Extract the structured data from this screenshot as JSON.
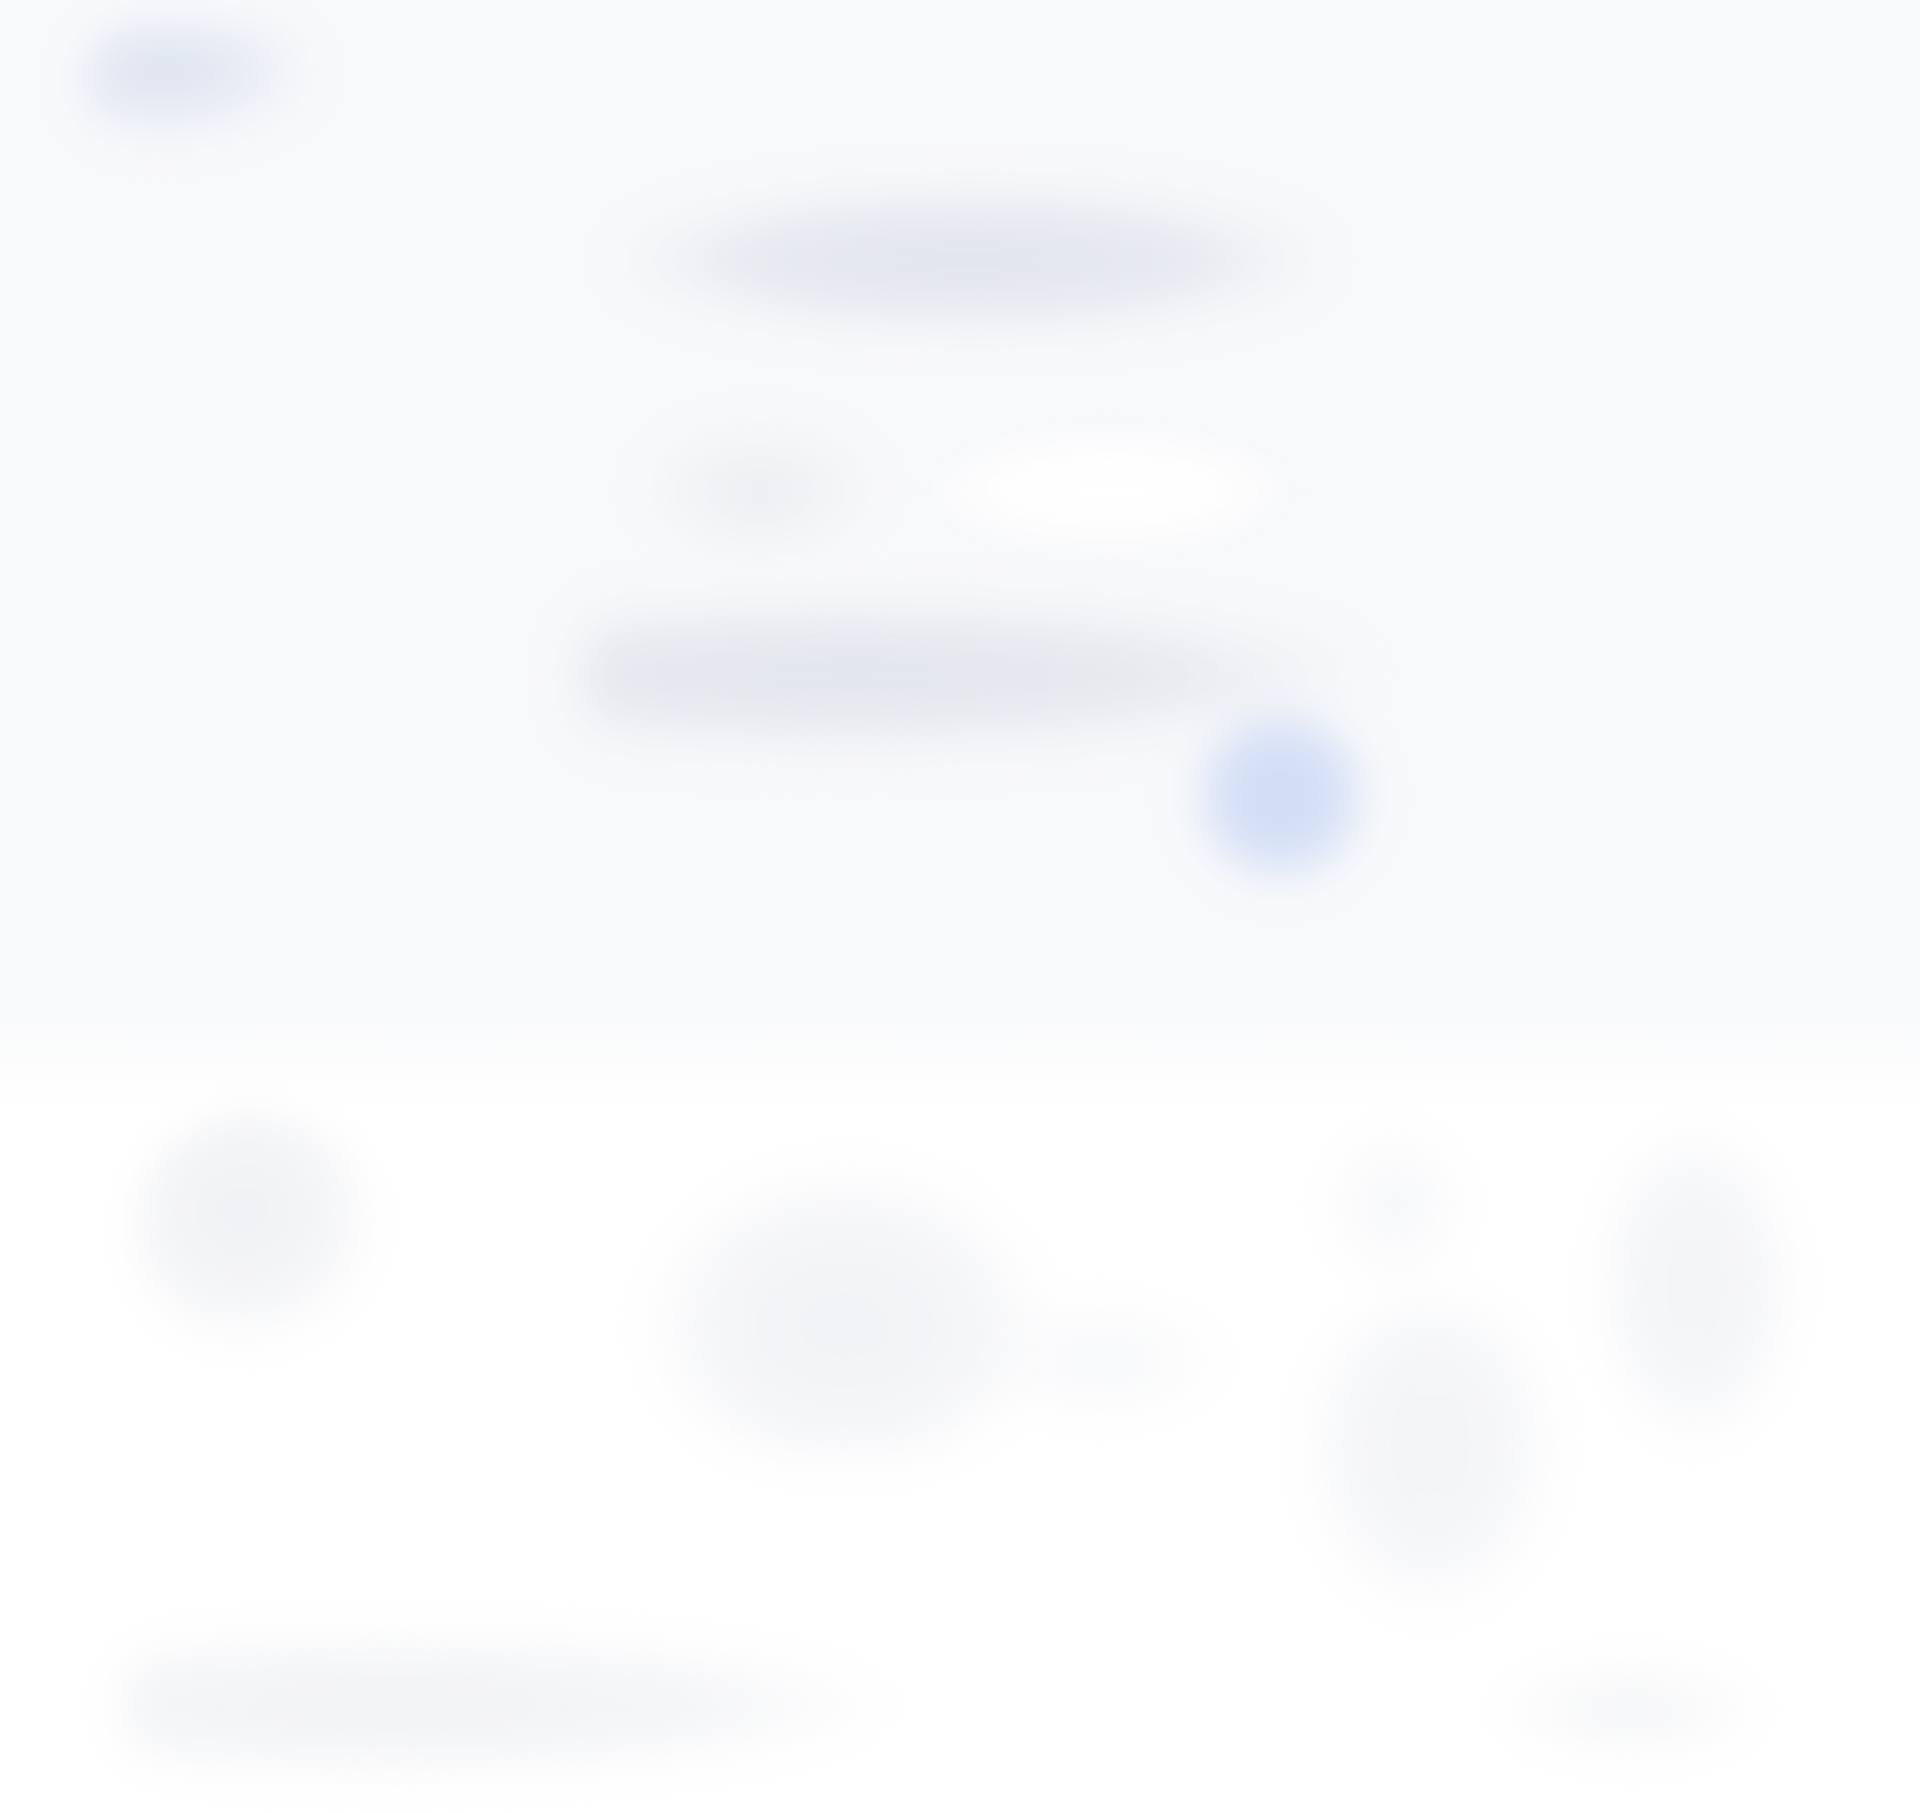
{
  "background": {
    "hero_color": "#f8f9fb",
    "page_color": "#ffffff",
    "accent_color": "#d3dff5"
  }
}
